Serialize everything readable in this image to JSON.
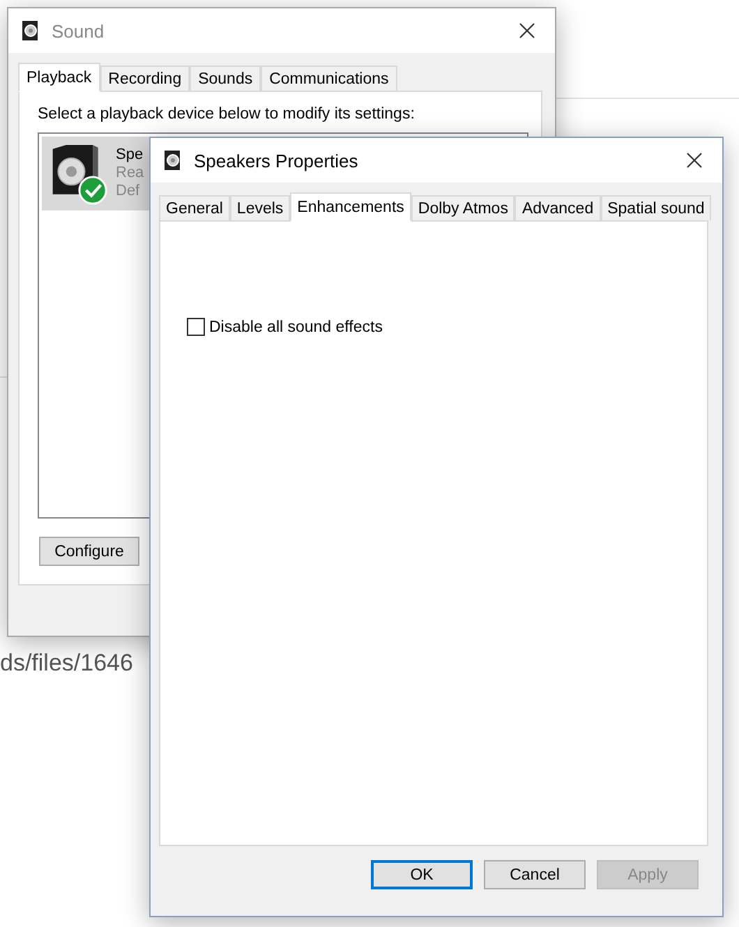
{
  "background": {
    "fragments": [
      {
        "text": "ds/files/1646"
      }
    ]
  },
  "sound_window": {
    "title": "Sound",
    "active": false,
    "tabs": [
      {
        "label": "Playback",
        "selected": true
      },
      {
        "label": "Recording",
        "selected": false
      },
      {
        "label": "Sounds",
        "selected": false
      },
      {
        "label": "Communications",
        "selected": false
      }
    ],
    "instruction": "Select a playback device below to modify its settings:",
    "devices": [
      {
        "name": "Spe",
        "status": "Rea",
        "role": "Def",
        "selected": true,
        "is_default": true
      }
    ],
    "buttons": [
      {
        "label": "Configure"
      }
    ]
  },
  "properties_window": {
    "title": "Speakers Properties",
    "tabs": [
      {
        "label": "General",
        "selected": false
      },
      {
        "label": "Levels",
        "selected": false
      },
      {
        "label": "Enhancements",
        "selected": true
      },
      {
        "label": "Dolby Atmos",
        "selected": false
      },
      {
        "label": "Advanced",
        "selected": false
      },
      {
        "label": "Spatial sound",
        "selected": false
      }
    ],
    "options": [
      {
        "label": "Disable all sound effects",
        "checked": false
      }
    ],
    "buttons": [
      {
        "label": "OK",
        "default": true,
        "disabled": false
      },
      {
        "label": "Cancel",
        "default": false,
        "disabled": false
      },
      {
        "label": "Apply",
        "default": false,
        "disabled": true
      }
    ]
  }
}
